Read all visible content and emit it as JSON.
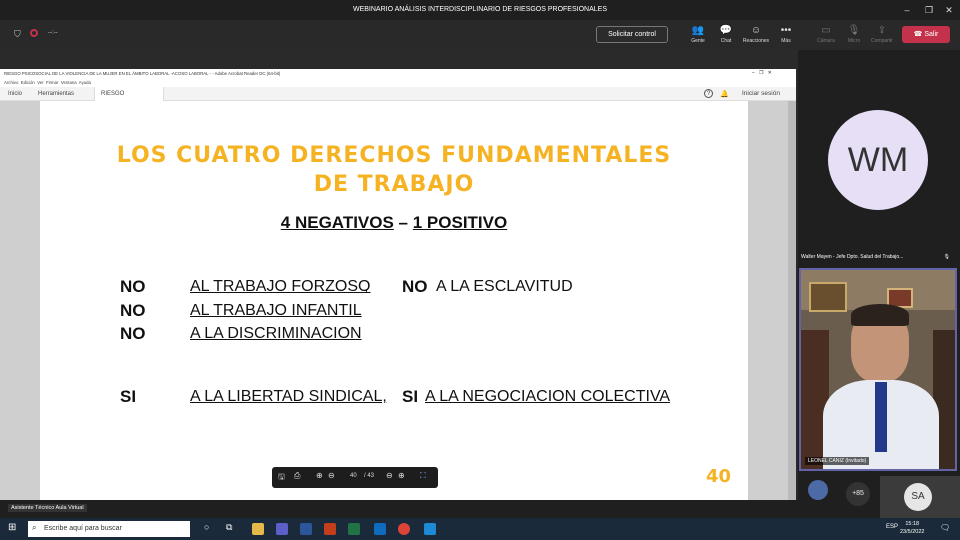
{
  "window": {
    "title": "WEBINARIO ANÁLISIS INTERDISCIPLINARIO DE RIESGOS PROFESIONALES"
  },
  "meeting": {
    "timer": "--:--",
    "request_control": "Solicitar control",
    "tools": [
      {
        "label": "Gente",
        "icon": "people-icon"
      },
      {
        "label": "Chat",
        "icon": "chat-icon"
      },
      {
        "label": "Reacciones",
        "icon": "reactions-icon"
      },
      {
        "label": "Más",
        "icon": "more-icon"
      }
    ],
    "disabled_tools": [
      {
        "label": "Cámara",
        "icon": "camera-icon"
      },
      {
        "label": "Micro",
        "icon": "mic-icon"
      },
      {
        "label": "Compartir",
        "icon": "share-icon"
      }
    ],
    "leave": "Salir"
  },
  "acrobat": {
    "title": "RIESGO PSICOSOCIAL DE LA VIOLENCIA DE LA MUJER EN EL ÁMBITO LABORAL -ACOSO LABORAL - - Adobe Acrobat Reader DC (64-bit)",
    "menu": [
      "Archivo",
      "Edición",
      "Ver",
      "Firmar",
      "Ventana",
      "Ayuda"
    ],
    "tabs": [
      "Inicio",
      "Herramientas",
      "RIESGO PSICOSOC..."
    ],
    "help": "?",
    "signin": "Iniciar sesión"
  },
  "slide": {
    "title_line1": "LOS CUATRO DERECHOS FUNDAMENTALES",
    "title_line2": "DE TRABAJO",
    "subtitle_a": "4 NEGATIVOS",
    "subtitle_dash": " – ",
    "subtitle_b": "1 POSITIVO",
    "rows": [
      {
        "kw": "NO",
        "text": "AL TRABAJO FORZOSO",
        "suffix": ",",
        "kw2": "NO",
        "text2": "A LA ESCLAVITUD"
      },
      {
        "kw": "NO",
        "text": "AL TRABAJO INFANTIL"
      },
      {
        "kw": "NO",
        "text": "A LA DISCRIMINACION"
      },
      {
        "kw": "SI",
        "text": "A LA LIBERTAD SINDICAL,",
        "kw2": "SI",
        "text2": "A LA NEGOCIACION COLECTIVA"
      }
    ],
    "page_number": "40"
  },
  "pdf_toolbar": {
    "page": "40",
    "total": "/ 43"
  },
  "participants": {
    "big_avatar": "WM",
    "speaker_label": "Walter Mayen - Jefe Dpto. Salud del Trabajo...",
    "video_name": "LEONEL CANIZ (Invitado)",
    "more_count": "+85",
    "sa": "SA",
    "assistant_label": "Asistente Técnico Aula Virtual"
  },
  "taskbar": {
    "search_placeholder": "Escribe aquí para buscar",
    "lang": "ESP",
    "time": "15:18",
    "date": "23/5/2022"
  }
}
